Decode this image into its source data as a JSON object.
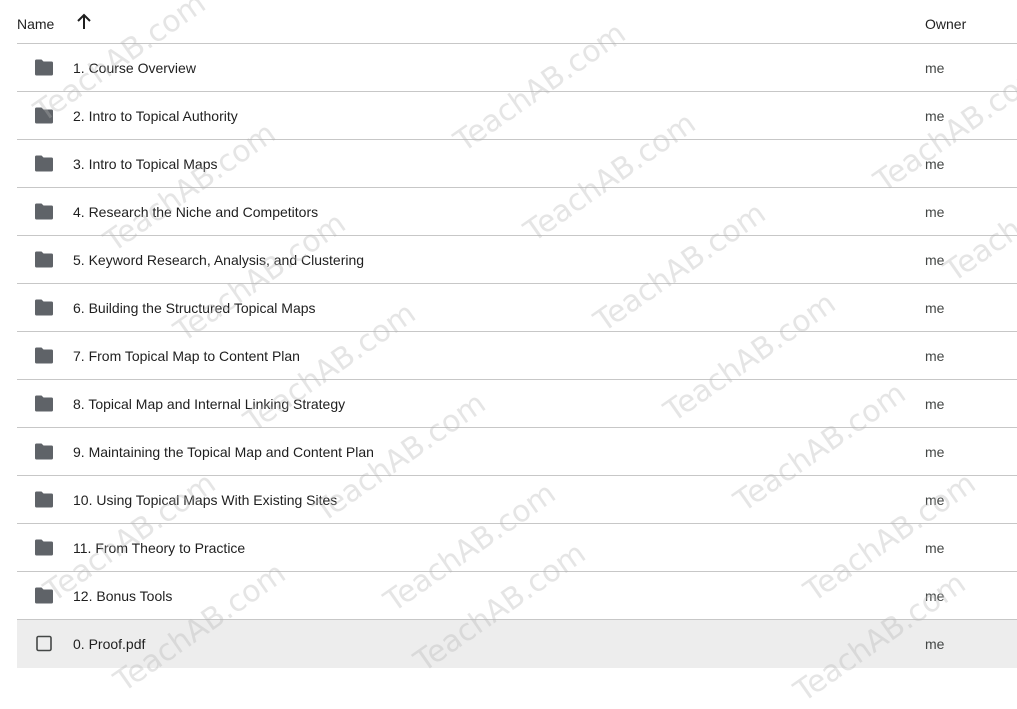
{
  "header": {
    "name_label": "Name",
    "sort_icon": "arrow-up-icon",
    "owner_label": "Owner"
  },
  "files": [
    {
      "name": "1. Course Overview",
      "type": "folder",
      "owner": "me"
    },
    {
      "name": "2. Intro to Topical Authority",
      "type": "folder",
      "owner": "me"
    },
    {
      "name": "3. Intro to Topical Maps",
      "type": "folder",
      "owner": "me"
    },
    {
      "name": "4. Research the Niche and Competitors",
      "type": "folder",
      "owner": "me"
    },
    {
      "name": "5. Keyword Research, Analysis, and Clustering",
      "type": "folder",
      "owner": "me"
    },
    {
      "name": "6. Building the Structured Topical Maps",
      "type": "folder",
      "owner": "me"
    },
    {
      "name": "7. From Topical Map to Content Plan",
      "type": "folder",
      "owner": "me"
    },
    {
      "name": "8. Topical Map and Internal Linking Strategy",
      "type": "folder",
      "owner": "me"
    },
    {
      "name": "9. Maintaining the Topical Map and Content Plan",
      "type": "folder",
      "owner": "me"
    },
    {
      "name": "10. Using Topical Maps With Existing Sites",
      "type": "folder",
      "owner": "me"
    },
    {
      "name": "11. From Theory to Practice",
      "type": "folder",
      "owner": "me"
    },
    {
      "name": "12. Bonus Tools",
      "type": "folder",
      "owner": "me"
    },
    {
      "name": "0. Proof.pdf",
      "type": "file",
      "owner": "me",
      "selected": true
    }
  ],
  "watermark_text": "TeachAB.com",
  "colors": {
    "folder_icon": "#5f6368",
    "divider": "#c7c7c7",
    "selected_row": "#ededed"
  }
}
